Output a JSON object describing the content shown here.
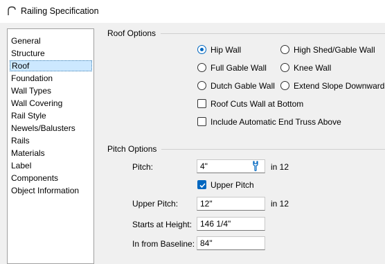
{
  "window": {
    "title": "Railing Specification",
    "icon": "railing-arc-icon"
  },
  "sidebar": {
    "items": [
      {
        "label": "General"
      },
      {
        "label": "Structure"
      },
      {
        "label": "Roof",
        "selected": true
      },
      {
        "label": "Foundation"
      },
      {
        "label": "Wall Types"
      },
      {
        "label": "Wall Covering"
      },
      {
        "label": "Rail Style"
      },
      {
        "label": "Newels/Balusters"
      },
      {
        "label": "Rails"
      },
      {
        "label": "Materials"
      },
      {
        "label": "Label"
      },
      {
        "label": "Components"
      },
      {
        "label": "Object Information"
      }
    ]
  },
  "roof_options": {
    "heading": "Roof Options",
    "radios": [
      {
        "label": "Hip Wall",
        "checked": true
      },
      {
        "label": "High Shed/Gable Wall",
        "checked": false
      },
      {
        "label": "Full Gable Wall",
        "checked": false
      },
      {
        "label": "Knee Wall",
        "checked": false
      },
      {
        "label": "Dutch Gable Wall",
        "checked": false
      },
      {
        "label": "Extend Slope Downward",
        "checked": false
      }
    ],
    "checkboxes": [
      {
        "label": "Roof Cuts Wall at Bottom",
        "checked": false
      },
      {
        "label": "Include Automatic End Truss Above",
        "checked": false
      }
    ]
  },
  "pitch_options": {
    "heading": "Pitch Options",
    "pitch": {
      "label": "Pitch:",
      "value": "4\"",
      "unit": "in 12"
    },
    "upper_pitch_check": {
      "label": "Upper Pitch",
      "checked": true
    },
    "upper_pitch": {
      "label": "Upper Pitch:",
      "value": "12\"",
      "unit": "in 12"
    },
    "starts_at_height": {
      "label": "Starts at Height:",
      "value": "146 1/4\""
    },
    "in_from_baseline": {
      "label": "In from Baseline:",
      "value": "84\""
    }
  },
  "colors": {
    "accent": "#0067c0",
    "selection": "#cce8ff"
  }
}
